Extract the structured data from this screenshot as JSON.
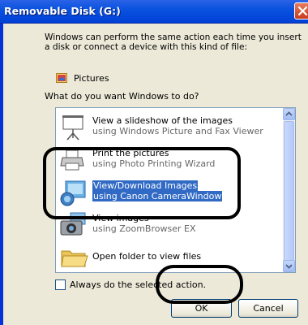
{
  "window": {
    "title": "Removable Disk (G:)",
    "close_icon": "close-icon"
  },
  "dialog": {
    "intro_line1": "Windows can perform the same action each time you insert",
    "intro_line2": "a disk or connect a device with this kind of file:",
    "content_type": {
      "icon": "pictures-icon",
      "label": "Pictures"
    },
    "question": "What do you want Windows to do?",
    "actions": [
      {
        "title": "View a slideshow of the images",
        "subtitle": "using Windows Picture and Fax Viewer",
        "icon": "projector-screen-icon"
      },
      {
        "title": "Print the pictures",
        "subtitle": "using Photo Printing Wizard",
        "icon": "printer-icon"
      },
      {
        "title": "View/Download Images",
        "subtitle": "using Canon CameraWindow",
        "icon": "camera-window-icon",
        "selected": true
      },
      {
        "title": "View images",
        "subtitle": "using ZoomBrowser EX",
        "icon": "zoombrowser-camera-icon"
      },
      {
        "title": "Open folder to view files",
        "subtitle": "",
        "icon": "folder-icon"
      }
    ],
    "always_label": "Always do the selected action.",
    "always_checked": false,
    "ok_label": "OK",
    "cancel_label": "Cancel"
  },
  "colors": {
    "title_bar": "#0a53e0",
    "dialog_bg": "#ece9d8",
    "selection": "#316ac5",
    "annotation": "#000000"
  }
}
